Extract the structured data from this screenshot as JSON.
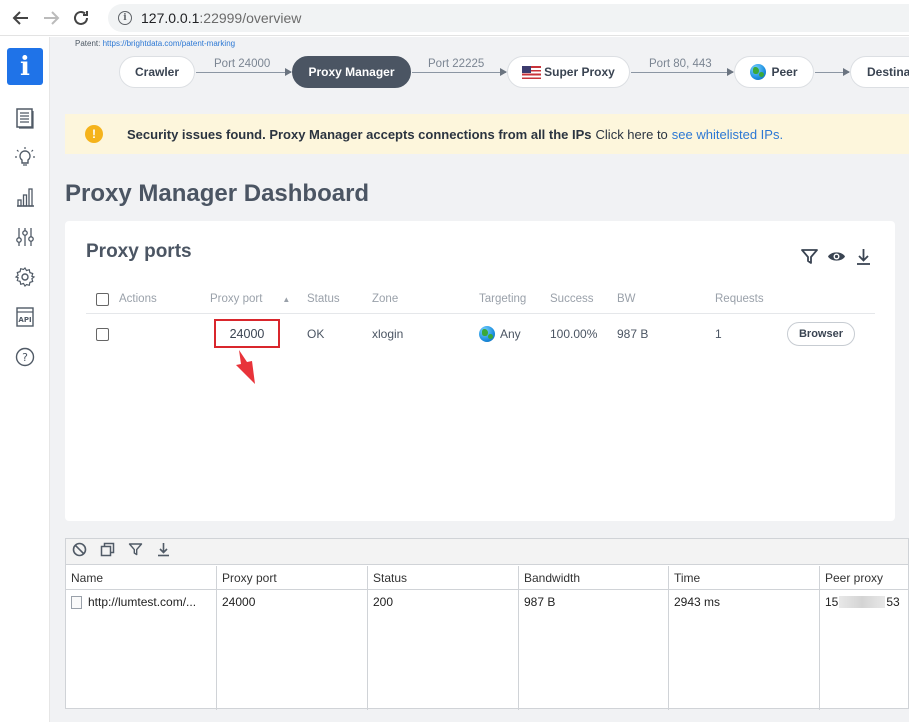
{
  "browser": {
    "url_host": "127.0.0.1",
    "url_path": ":22999/overview"
  },
  "patent": {
    "label": "Patent:",
    "link": "https://brightdata.com/patent-marking"
  },
  "flow": {
    "nodes": [
      "Crawler",
      "Proxy Manager",
      "Super Proxy",
      "Peer",
      "Destinat"
    ],
    "ports": [
      "Port 24000",
      "Port 22225",
      "Port 80, 443"
    ]
  },
  "alert": {
    "strong": "Security issues found. Proxy Manager accepts connections from all the IPs",
    "text": "Click here to",
    "link": "see whitelisted IPs."
  },
  "dashboard_title": "Proxy Manager Dashboard",
  "proxy_ports": {
    "title": "Proxy ports",
    "columns": [
      "Actions",
      "Proxy port",
      "Status",
      "Zone",
      "Targeting",
      "Success",
      "BW",
      "Requests"
    ],
    "row": {
      "port": "24000",
      "status": "OK",
      "zone": "xlogin",
      "targeting": "Any",
      "success": "100.00%",
      "bw": "987 B",
      "requests": "1",
      "button": "Browser"
    }
  },
  "log": {
    "columns": [
      "Name",
      "Proxy port",
      "Status",
      "Bandwidth",
      "Time",
      "Peer proxy"
    ],
    "row": {
      "name": "http://lumtest.com/...",
      "port": "24000",
      "status": "200",
      "bandwidth": "987 B",
      "time": "2943 ms",
      "peer_start": "15",
      "peer_end": "53"
    }
  },
  "colors": {
    "accent": "#1f73e8",
    "pill_dark": "#4b5563",
    "alert_bg": "#fdf6dc",
    "warning": "#f5b31b",
    "highlight": "#d9262c"
  }
}
